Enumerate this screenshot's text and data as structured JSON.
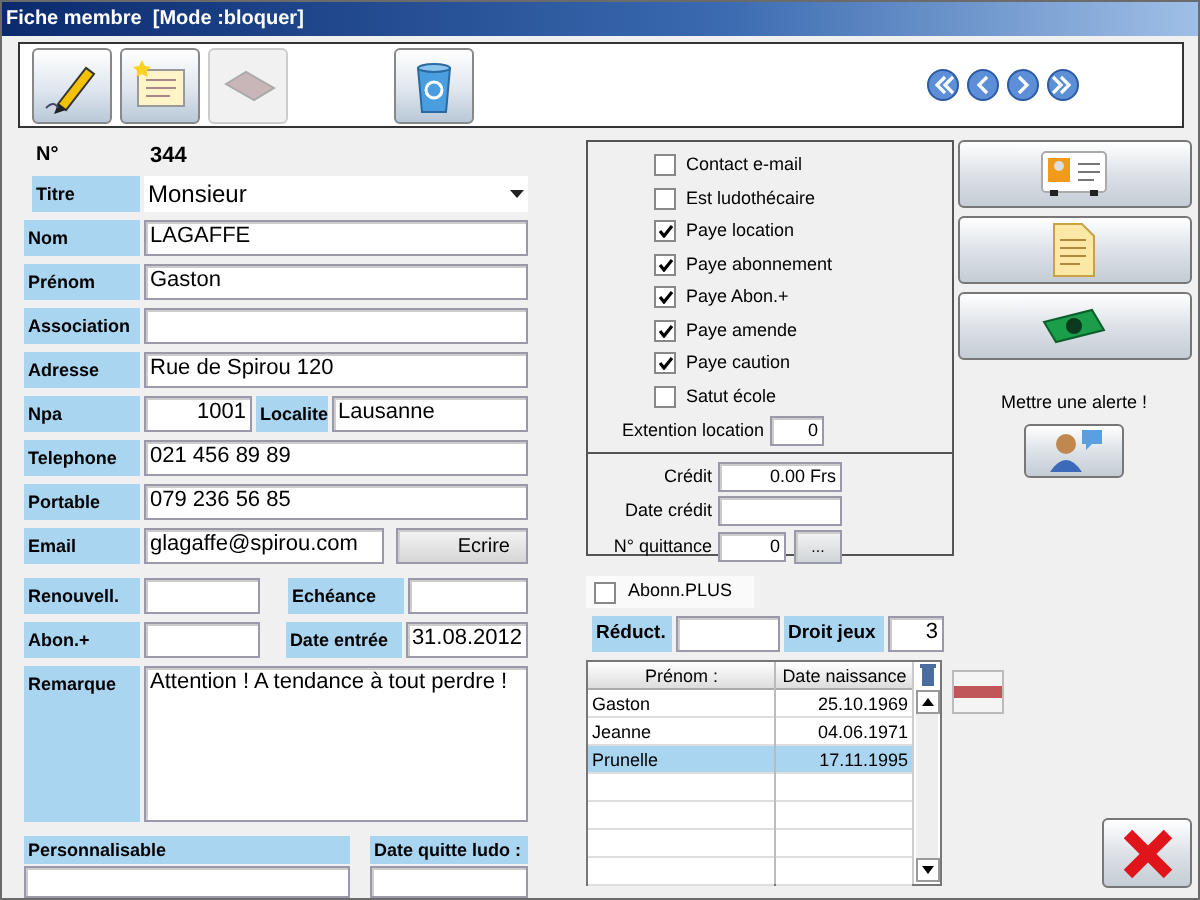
{
  "window": {
    "title": "Fiche membre  [Mode :bloquer]"
  },
  "toolbar": {
    "buttons": [
      {
        "kind": "edit",
        "disabled": false
      },
      {
        "kind": "new",
        "disabled": false
      },
      {
        "kind": "erase",
        "disabled": true
      },
      {
        "kind": "delete",
        "disabled": false
      }
    ],
    "navigation": [
      {
        "kind": "first"
      },
      {
        "kind": "previous"
      },
      {
        "kind": "next"
      },
      {
        "kind": "last"
      }
    ]
  },
  "member": {
    "number_label": "N°",
    "number": "344",
    "rows": [
      {
        "kind": "select",
        "label": "Titre",
        "value": "Monsieur"
      },
      {
        "kind": "text",
        "label": "Nom",
        "value": "LAGAFFE"
      },
      {
        "kind": "text",
        "label": "Prénom",
        "value": "Gaston"
      },
      {
        "kind": "text",
        "label": "Association",
        "value": ""
      },
      {
        "kind": "text",
        "label": "Adresse",
        "value": "Rue de Spirou 120"
      },
      {
        "kind": "npa",
        "label": "Npa",
        "value": "1001",
        "label_2": "Localite",
        "value_2": "Lausanne"
      },
      {
        "kind": "text",
        "label": "Telephone",
        "value": "021 456 89 89"
      },
      {
        "kind": "text",
        "label": "Portable",
        "value": "079 236 56 85"
      },
      {
        "kind": "email",
        "label": "Email",
        "value": "glagaffe@spirou.com",
        "button": "Ecrire"
      },
      {
        "kind": "pair",
        "label": "Renouvell.",
        "value": "",
        "label_2": "Echéance",
        "value_2": ""
      },
      {
        "kind": "pair",
        "label": "Abon.+",
        "value": "",
        "label_2": "Date entrée",
        "value_2": "31.08.2012"
      },
      {
        "kind": "memo",
        "label": "Remarque",
        "value": "Attention ! A tendance à tout perdre !"
      }
    ],
    "bottom": [
      {
        "label": "Personnalisable"
      },
      {
        "label": "Date quitte ludo :"
      }
    ]
  },
  "options": {
    "checkboxes": [
      {
        "label": "Contact e-mail",
        "checked": false
      },
      {
        "label": "Est ludothécaire",
        "checked": false
      },
      {
        "label": "Paye location",
        "checked": true
      },
      {
        "label": "Paye abonnement",
        "checked": true
      },
      {
        "label": "Paye Abon.+",
        "checked": true
      },
      {
        "label": "Paye amende",
        "checked": true
      },
      {
        "label": "Paye caution",
        "checked": true
      },
      {
        "label": "Satut école",
        "checked": false
      }
    ],
    "extension": {
      "label": "Extention location",
      "value": "0"
    },
    "credit": [
      {
        "label": "Crédit",
        "value": "0.00 Frs"
      },
      {
        "label": "Date crédit"
      },
      {
        "label": "N° quittance",
        "value": "0",
        "button": "..."
      }
    ]
  },
  "abonn_plus": {
    "label": "Abonn.PLUS",
    "checked": false
  },
  "reduction": {
    "label": "Réduct.",
    "label_2": "Droit jeux",
    "value_2": "3"
  },
  "family": {
    "columns": [
      "Prénom :",
      "Date naissance"
    ],
    "rows": [
      {
        "name": "Gaston",
        "birth": "25.10.1969",
        "selected": false
      },
      {
        "name": "Jeanne",
        "birth": "04.06.1971",
        "selected": false
      },
      {
        "name": "Prunelle",
        "birth": "17.11.1995",
        "selected": true
      }
    ]
  },
  "side_buttons": [
    {
      "kind": "card"
    },
    {
      "kind": "document"
    },
    {
      "kind": "money"
    }
  ],
  "alert": {
    "label": "Mettre une alerte !"
  }
}
